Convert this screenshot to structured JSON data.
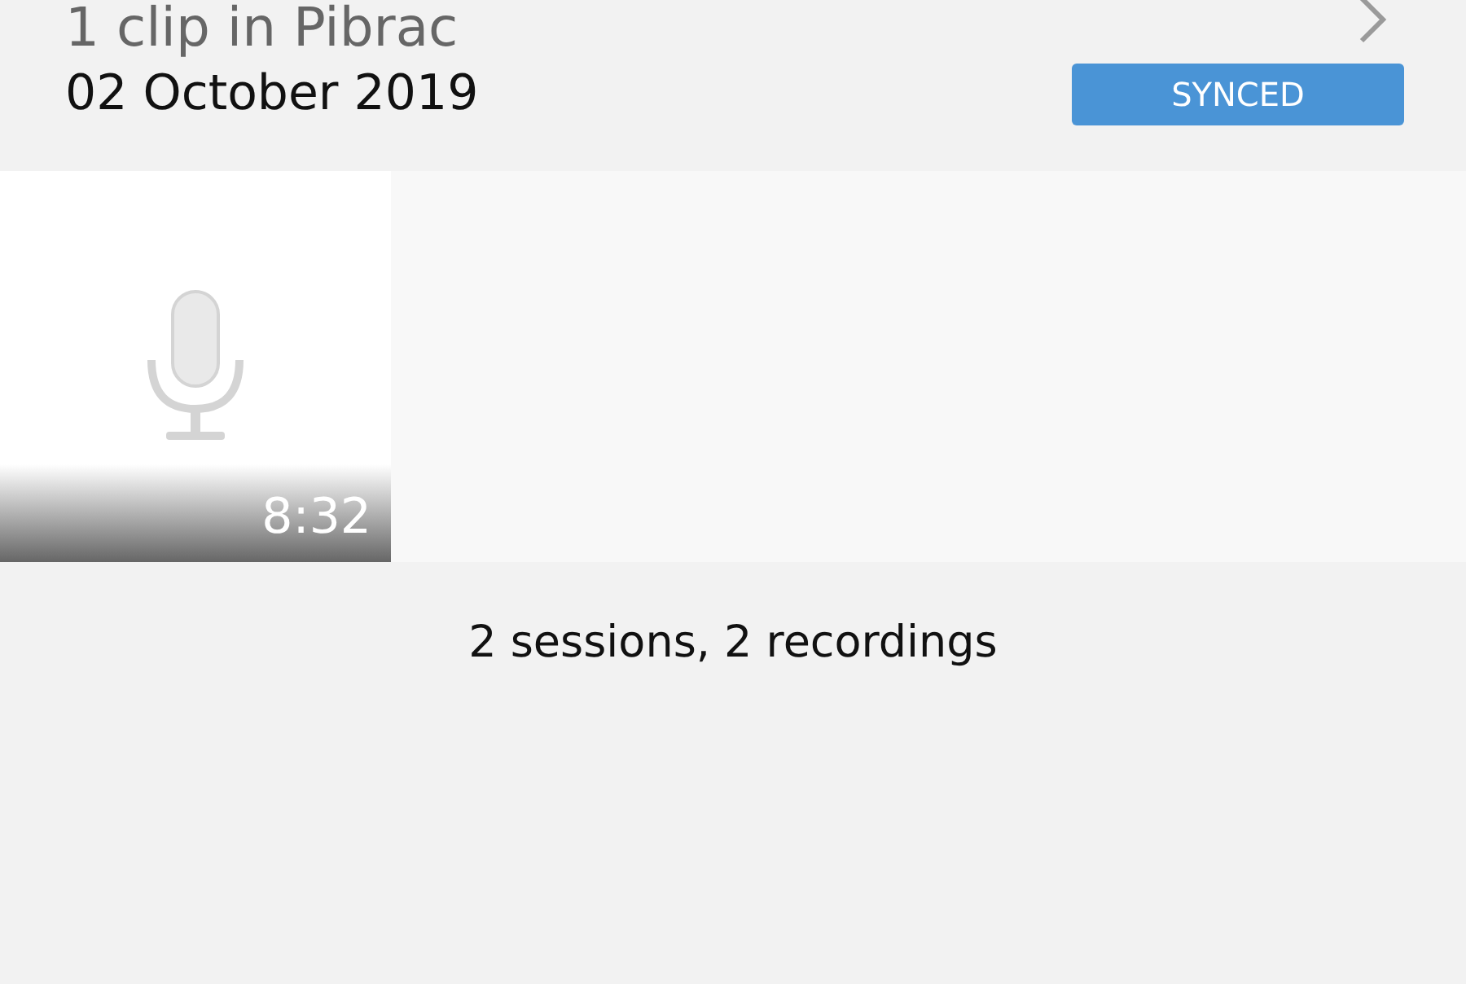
{
  "header": {
    "title": "1 clip in Pibrac",
    "date": "02 October 2019",
    "status": "SYNCED"
  },
  "clips": [
    {
      "kind": "audio",
      "duration": "8:32"
    }
  ],
  "summary": "2 sessions, 2 recordings"
}
